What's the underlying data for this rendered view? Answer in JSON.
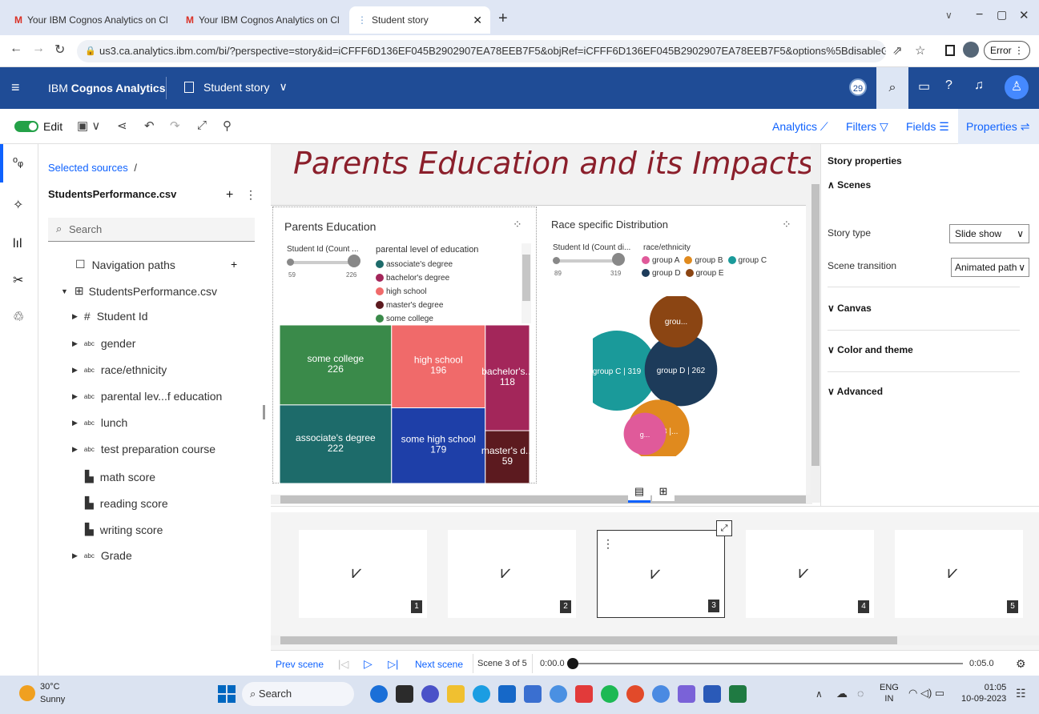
{
  "browser": {
    "tabs": [
      {
        "label": "Your IBM Cognos Analytics on Cl"
      },
      {
        "label": "Your IBM Cognos Analytics on Cl"
      },
      {
        "label": "Student story"
      }
    ],
    "url": "us3.ca.analytics.ibm.com/bi/?perspective=story&id=iCFFF6D136EF045B2902907EA78EEB7F5&objRef=iCFFF6D136EF045B2902907EA78EEB7F5&options%5BdisableGlassPrefetch%5D=true&...",
    "error_label": "Error"
  },
  "app": {
    "product_prefix": "IBM ",
    "product_name": "Cognos Analytics",
    "story_title": "Student story",
    "notification_count": "29"
  },
  "toolbar": {
    "edit_label": "Edit",
    "analytics": "Analytics",
    "filters": "Filters",
    "fields": "Fields",
    "properties": "Properties"
  },
  "sources": {
    "breadcrumb": "Selected sources",
    "separator": "/",
    "file": "StudentsPerformance.csv",
    "add": "+",
    "more": "⋮",
    "search_placeholder": "Search",
    "items": [
      {
        "icon": "☐",
        "label": "Navigation paths"
      },
      {
        "icon": "⊞",
        "label": "StudentsPerformance.csv"
      },
      {
        "icon": "#",
        "label": "Student Id"
      },
      {
        "icon": "abc",
        "label": "gender"
      },
      {
        "icon": "abc",
        "label": "race/ethnicity"
      },
      {
        "icon": "abc",
        "label": "parental lev...f education"
      },
      {
        "icon": "abc",
        "label": "lunch"
      },
      {
        "icon": "abc",
        "label": "test preparation course"
      },
      {
        "icon": "▙",
        "label": "math score"
      },
      {
        "icon": "▙",
        "label": "reading score"
      },
      {
        "icon": "▙",
        "label": "writing score"
      },
      {
        "icon": "abc",
        "label": "Grade"
      }
    ]
  },
  "canvas": {
    "title": "Parents Education and its Impacts"
  },
  "chart1": {
    "title": "Parents Education",
    "slider_label": "Student Id (Count ...",
    "slider_min": "59",
    "slider_max": "226",
    "legend_title": "parental level of education"
  },
  "chart2": {
    "title": "Race specific Distribution",
    "slider_label": "Student Id (Count di...",
    "slider_min": "89",
    "slider_max": "319",
    "legend_title": "race/ethnicity"
  },
  "chart_data": [
    {
      "type": "treemap",
      "title": "Parents Education",
      "series": [
        {
          "name": "some college",
          "value": 226,
          "label": "some college",
          "color": "#3a8a4a"
        },
        {
          "name": "associate's degree",
          "value": 222,
          "label": "associate's degree",
          "color": "#1d6b6a"
        },
        {
          "name": "high school",
          "value": 196,
          "label": "high school",
          "color": "#f06a6a"
        },
        {
          "name": "some high school",
          "value": 179,
          "label": "some high school",
          "color": "#1e3fa8"
        },
        {
          "name": "bachelor's degree",
          "value": 118,
          "label": "bachelor's...",
          "color": "#a3265a"
        },
        {
          "name": "master's degree",
          "value": 59,
          "label": "master's d...",
          "color": "#5c1a1f"
        }
      ],
      "legend": [
        {
          "label": "associate's degree",
          "color": "#1d6b6a"
        },
        {
          "label": "bachelor's degree",
          "color": "#a3265a"
        },
        {
          "label": "high school",
          "color": "#f06a6a"
        },
        {
          "label": "master's degree",
          "color": "#5c1a1f"
        },
        {
          "label": "some college",
          "color": "#3a8a4a"
        }
      ]
    },
    {
      "type": "bubble",
      "title": "Race specific Distribution",
      "series": [
        {
          "name": "group C",
          "value": 319,
          "label": "group C | 319",
          "color": "#1a9a9a"
        },
        {
          "name": "group D",
          "value": 262,
          "label": "group D | 262",
          "color": "#1d3b5a"
        },
        {
          "name": "group B",
          "value": 190,
          "label": "group B |...",
          "color": "#e08a1e"
        },
        {
          "name": "group E",
          "value": 140,
          "label": "grou...",
          "color": "#8b4513"
        },
        {
          "name": "group A",
          "value": 89,
          "label": "g...",
          "color": "#e05a9a"
        }
      ],
      "legend": [
        {
          "label": "group A",
          "color": "#e05a9a"
        },
        {
          "label": "group B",
          "color": "#e08a1e"
        },
        {
          "label": "group C",
          "color": "#1a9a9a"
        },
        {
          "label": "group D",
          "color": "#1d3b5a"
        },
        {
          "label": "group E",
          "color": "#8b4513"
        }
      ]
    }
  ],
  "properties": {
    "title": "Story properties",
    "scenes": "Scenes",
    "story_type_label": "Story type",
    "story_type_value": "Slide show",
    "transition_label": "Scene transition",
    "transition_value": "Animated path",
    "canvas": "Canvas",
    "color_theme": "Color and theme",
    "advanced": "Advanced"
  },
  "timeline": {
    "scenes": [
      {
        "num": "1"
      },
      {
        "num": "2"
      },
      {
        "num": "3"
      },
      {
        "num": "4"
      },
      {
        "num": "5"
      }
    ],
    "prev": "Prev scene",
    "next": "Next scene",
    "scene_counter": "Scene 3 of 5",
    "time_start": "0:00.0",
    "time_end": "0:05.0"
  },
  "taskbar": {
    "temp": "30°C",
    "weather": "Sunny",
    "search": "Search",
    "lang": "ENG",
    "region": "IN",
    "time": "01:05",
    "date": "10-09-2023"
  }
}
